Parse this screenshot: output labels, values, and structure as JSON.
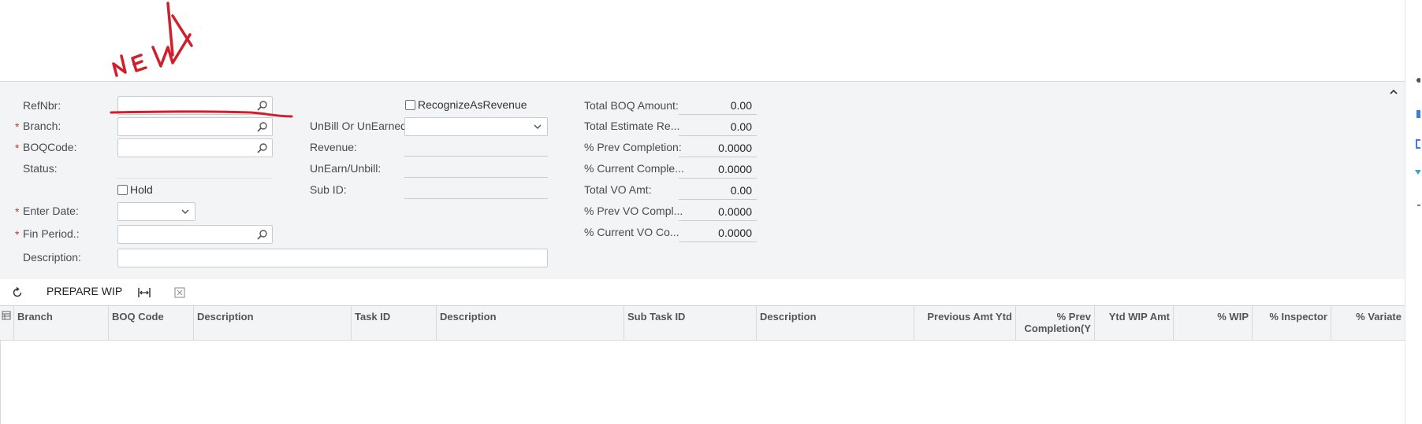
{
  "annotation": {
    "text": "NEW",
    "color": "#d01f2a"
  },
  "form": {
    "refnbr": {
      "label": "RefNbr:",
      "value": ""
    },
    "branch": {
      "label": "Branch:",
      "value": ""
    },
    "boqcode": {
      "label": "BOQCode:",
      "value": ""
    },
    "status": {
      "label": "Status:",
      "value": ""
    },
    "hold": {
      "label": "Hold",
      "checked": false
    },
    "enter_date": {
      "label": "Enter Date:",
      "value": ""
    },
    "fin_period": {
      "label": "Fin Period.:",
      "value": ""
    },
    "description": {
      "label": "Description:",
      "value": ""
    },
    "recognize_as_revenue": {
      "label": "RecognizeAsRevenue",
      "checked": false
    },
    "unbill_or_unearned": {
      "label": "UnBill Or UnEarned:",
      "value": ""
    },
    "revenue": {
      "label": "Revenue:",
      "value": ""
    },
    "unearn_unbill": {
      "label": "UnEarn/Unbill:",
      "value": ""
    },
    "sub_id": {
      "label": "Sub ID:",
      "value": ""
    },
    "totals": [
      {
        "label": "Total BOQ Amount:",
        "value": "0.00"
      },
      {
        "label": "Total Estimate Re...",
        "value": "0.00"
      },
      {
        "label": "% Prev Completion:",
        "value": "0.0000"
      },
      {
        "label": "% Current Comple...",
        "value": "0.0000"
      },
      {
        "label": "Total VO Amt:",
        "value": "0.00"
      },
      {
        "label": "% Prev VO Compl...",
        "value": "0.0000"
      },
      {
        "label": "% Current VO Co...",
        "value": "0.0000"
      }
    ]
  },
  "toolbar": {
    "refresh_icon": "refresh-icon",
    "prepare_wip": "PREPARE WIP",
    "fit_columns_icon": "fit-columns-icon",
    "export_excel_icon": "export-excel-icon"
  },
  "grid": {
    "columns": [
      {
        "label": "Branch"
      },
      {
        "label": "BOQ Code"
      },
      {
        "label": "Description"
      },
      {
        "label": "Task ID"
      },
      {
        "label": "Description"
      },
      {
        "label": "Sub Task ID"
      },
      {
        "label": "Description"
      },
      {
        "label": "Previous Amt Ytd"
      },
      {
        "label": "% Prev Completion(Y"
      },
      {
        "label": "Ytd WIP Amt"
      },
      {
        "label": "% WIP"
      },
      {
        "label": "% Inspector"
      },
      {
        "label": "% Variate"
      }
    ],
    "rows": []
  },
  "colors": {
    "panel_bg": "#f3f4f6",
    "required": "#c0392b",
    "border": "#c8ccd2"
  }
}
